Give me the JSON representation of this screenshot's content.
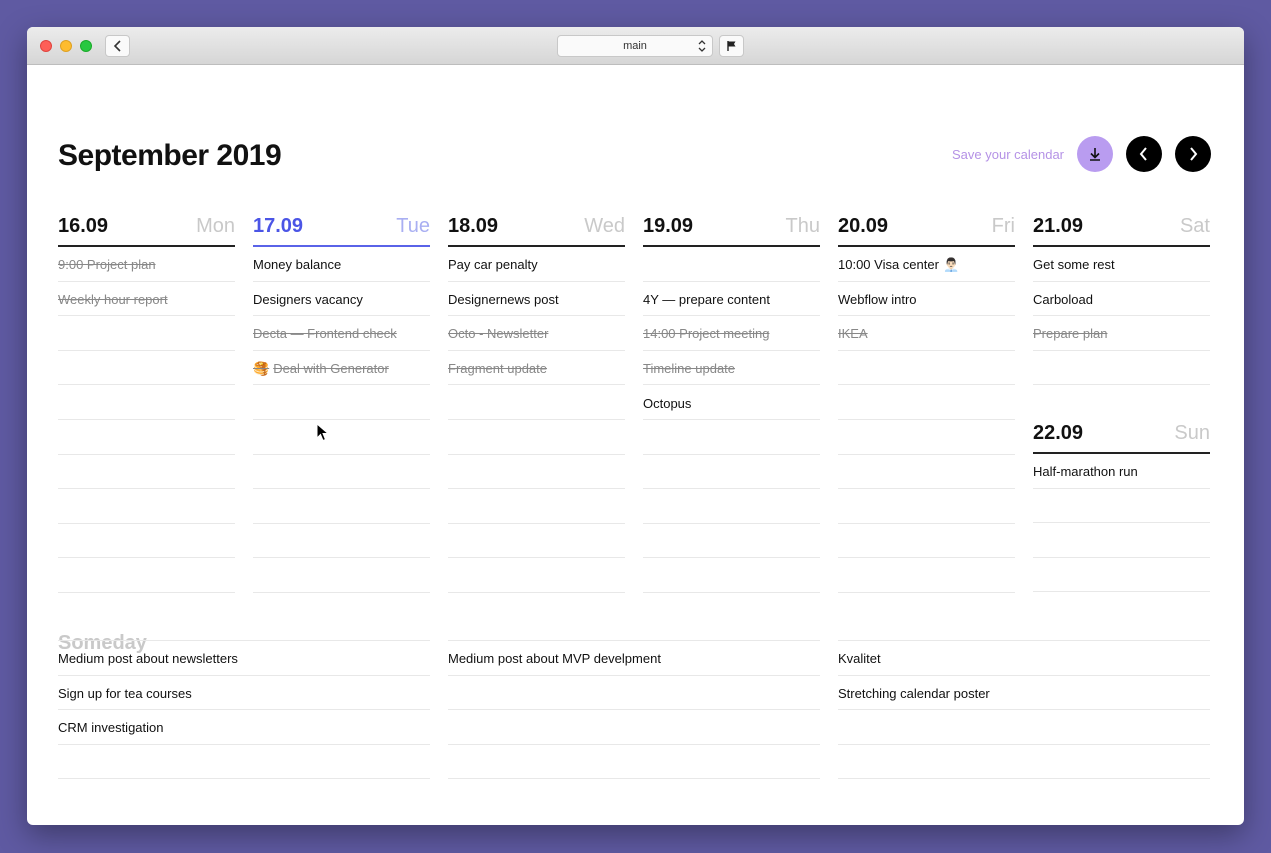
{
  "titlebar": {
    "tab": "main"
  },
  "header": {
    "title": "September 2019",
    "save_label": "Save your calendar"
  },
  "colors": {
    "accent": "#4b55e6",
    "save": "#b99cf0",
    "background": "#5f5aa2"
  },
  "days": [
    {
      "date": "16.09",
      "name": "Mon",
      "items": [
        {
          "text": "9:00 Project plan",
          "done": true
        },
        {
          "text": "Weekly hour report",
          "done": true
        },
        {
          "text": "",
          "done": false
        },
        {
          "text": "",
          "done": false
        },
        {
          "text": "",
          "done": false
        },
        {
          "text": "",
          "done": false
        },
        {
          "text": "",
          "done": false
        },
        {
          "text": "",
          "done": false
        },
        {
          "text": "",
          "done": false
        },
        {
          "text": "",
          "done": false
        }
      ]
    },
    {
      "date": "17.09",
      "name": "Tue",
      "today": true,
      "items": [
        {
          "text": "Money balance",
          "done": false
        },
        {
          "text": "Designers vacancy",
          "done": false
        },
        {
          "text": "Decta — Frontend check",
          "done": true
        },
        {
          "text": "Deal with Generator",
          "done": true,
          "emoji": "🥞"
        },
        {
          "text": "",
          "done": false
        },
        {
          "text": "",
          "done": false
        },
        {
          "text": "",
          "done": false
        },
        {
          "text": "",
          "done": false
        },
        {
          "text": "",
          "done": false
        },
        {
          "text": "",
          "done": false
        }
      ]
    },
    {
      "date": "18.09",
      "name": "Wed",
      "items": [
        {
          "text": "Pay car penalty",
          "done": false
        },
        {
          "text": "Designernews post",
          "done": false
        },
        {
          "text": "Octo - Newsletter",
          "done": true
        },
        {
          "text": "Fragment update",
          "done": true
        },
        {
          "text": "",
          "done": false
        },
        {
          "text": "",
          "done": false
        },
        {
          "text": "",
          "done": false
        },
        {
          "text": "",
          "done": false
        },
        {
          "text": "",
          "done": false
        },
        {
          "text": "",
          "done": false
        }
      ]
    },
    {
      "date": "19.09",
      "name": "Thu",
      "items": [
        {
          "text": "",
          "done": false
        },
        {
          "text": "4Y — prepare content",
          "done": false
        },
        {
          "text": "14:00 Project meeting",
          "done": true
        },
        {
          "text": "Timeline update",
          "done": true
        },
        {
          "text": "Octopus",
          "done": false
        },
        {
          "text": "",
          "done": false
        },
        {
          "text": "",
          "done": false
        },
        {
          "text": "",
          "done": false
        },
        {
          "text": "",
          "done": false
        },
        {
          "text": "",
          "done": false
        }
      ]
    },
    {
      "date": "20.09",
      "name": "Fri",
      "items": [
        {
          "text": "10:00 Visa center",
          "done": false,
          "emoji": "👨🏻‍💼"
        },
        {
          "text": "Webflow intro",
          "done": false
        },
        {
          "text": "IKEA",
          "done": true
        },
        {
          "text": "",
          "done": false
        },
        {
          "text": "",
          "done": false
        },
        {
          "text": "",
          "done": false
        },
        {
          "text": "",
          "done": false
        },
        {
          "text": "",
          "done": false
        },
        {
          "text": "",
          "done": false
        },
        {
          "text": "",
          "done": false
        }
      ]
    },
    {
      "date": "21.09",
      "name": "Sat",
      "items": [
        {
          "text": "Get some rest",
          "done": false
        },
        {
          "text": "Carboload",
          "done": false
        },
        {
          "text": "Prepare plan",
          "done": true
        },
        {
          "text": "",
          "done": false
        }
      ]
    },
    {
      "date": "22.09",
      "name": "Sun",
      "items": [
        {
          "text": "Half-marathon run",
          "done": false
        },
        {
          "text": "",
          "done": false
        },
        {
          "text": "",
          "done": false
        },
        {
          "text": "",
          "done": false
        }
      ]
    }
  ],
  "someday": {
    "title": "Someday",
    "columns": [
      [
        "Medium post about newsletters",
        "Sign up for tea courses",
        "CRM investigation",
        ""
      ],
      [
        "Medium post about MVP develpment",
        "",
        "",
        ""
      ],
      [
        "Kvalitet",
        "Stretching calendar poster",
        "",
        ""
      ]
    ]
  }
}
